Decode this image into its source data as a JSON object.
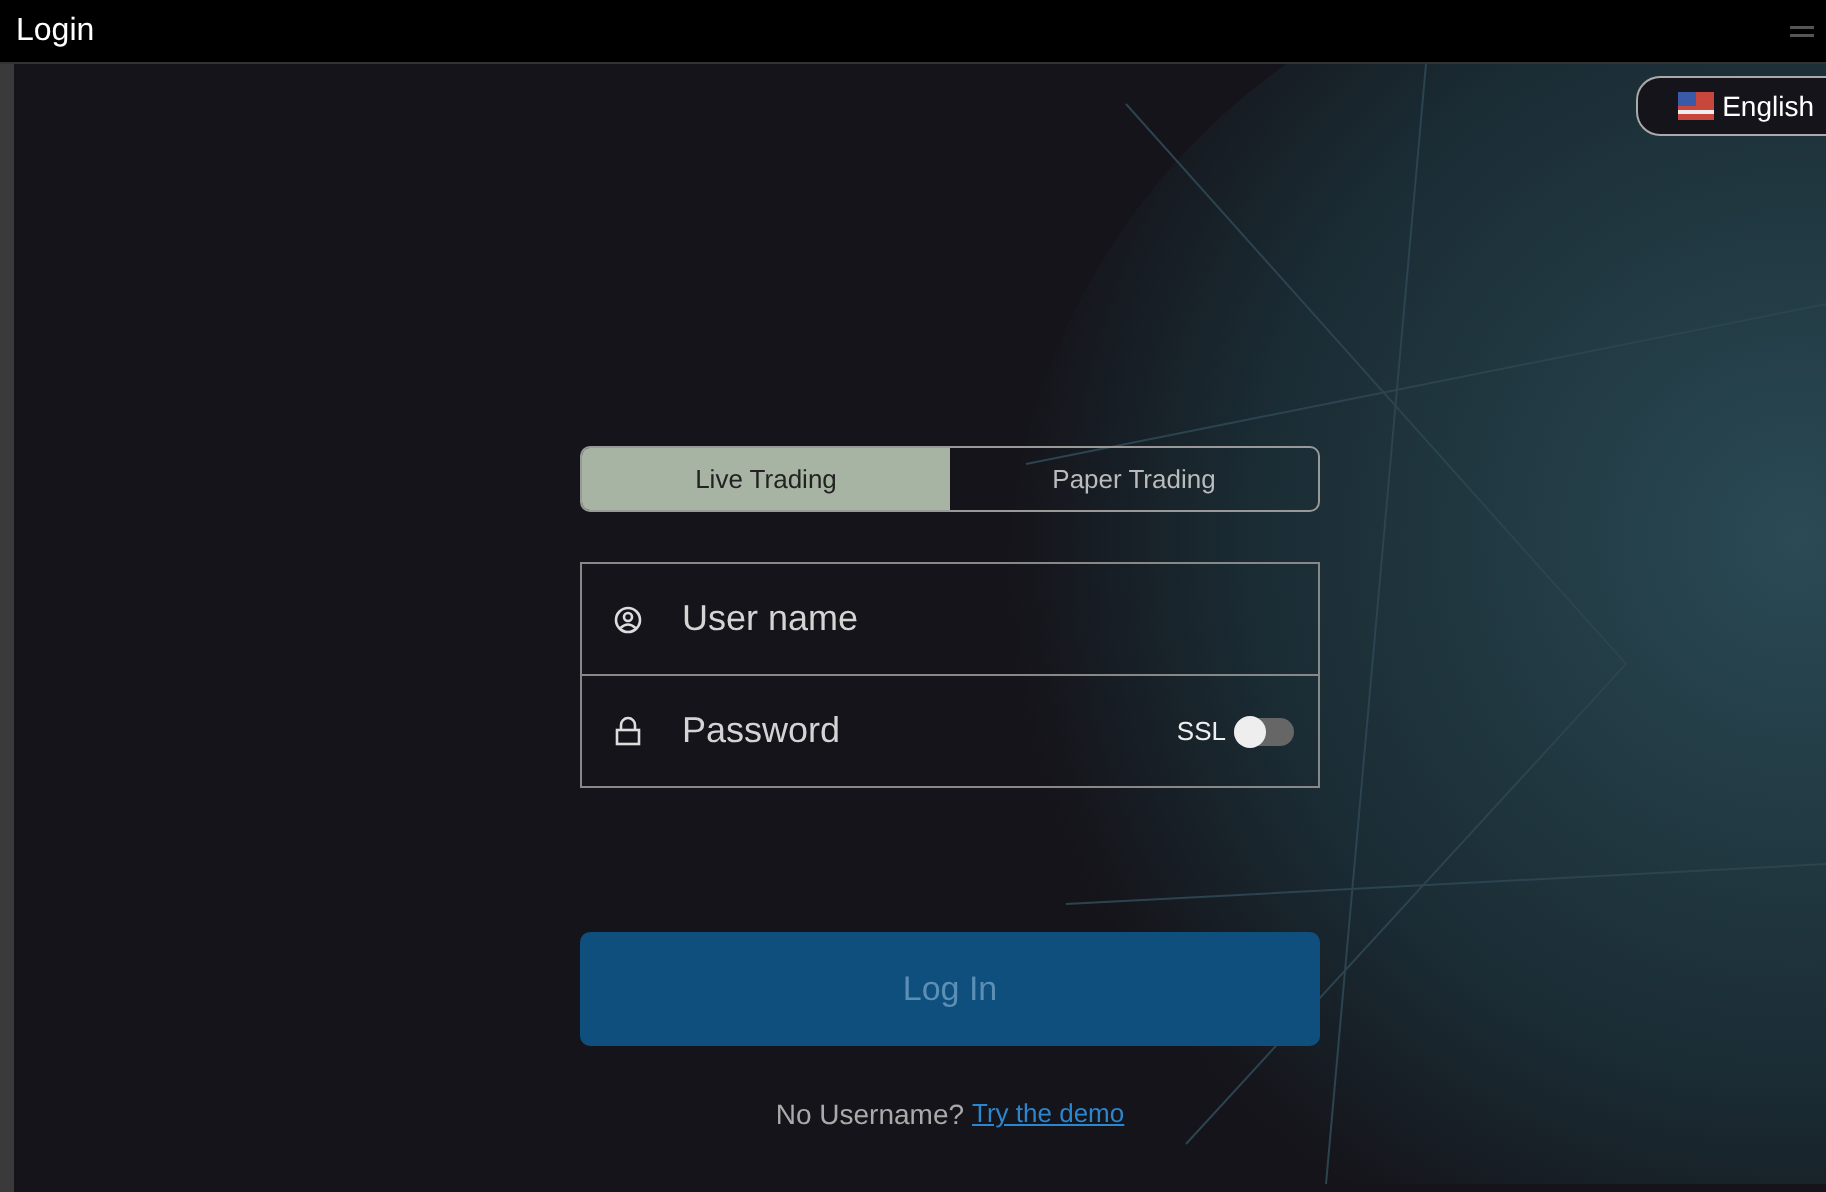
{
  "window": {
    "title": "Login"
  },
  "language": {
    "label": "English"
  },
  "tabs": [
    {
      "label": "Live Trading",
      "selected": true
    },
    {
      "label": "Paper Trading",
      "selected": false
    }
  ],
  "fields": [
    {
      "kind": "user",
      "placeholder": "User name"
    },
    {
      "kind": "password",
      "placeholder": "Password",
      "ssl": {
        "label": "SSL",
        "on": false
      }
    }
  ],
  "login_button": {
    "label": "Log In",
    "disabled": true
  },
  "footer": {
    "text": "No Username?",
    "link": "Try the demo"
  }
}
